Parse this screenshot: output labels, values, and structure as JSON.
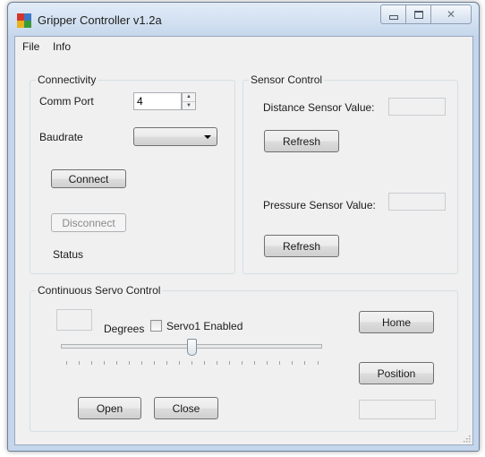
{
  "window": {
    "title": "Gripper Controller v1.2a",
    "controls": {
      "minimize": "minimize",
      "maximize": "maximize",
      "close": "✕"
    }
  },
  "menu": {
    "items": [
      "File",
      "Info"
    ]
  },
  "connectivity": {
    "title": "Connectivity",
    "comm_port_label": "Comm Port",
    "comm_port_value": "4",
    "baudrate_label": "Baudrate",
    "baudrate_value": "",
    "connect_label": "Connect",
    "disconnect_label": "Disconnect",
    "status_label": "Status"
  },
  "sensor_control": {
    "title": "Sensor Control",
    "distance_label": "Distance Sensor Value:",
    "distance_value": "",
    "refresh_distance_label": "Refresh",
    "pressure_label": "Pressure Sensor Value:",
    "pressure_value": "",
    "refresh_pressure_label": "Refresh"
  },
  "servo_control": {
    "title": "Continuous Servo Control",
    "degrees_value": "",
    "degrees_label": "Degrees",
    "servo1_label": "Servo1 Enabled",
    "servo1_checked": false,
    "slider_fraction": 0.5,
    "home_label": "Home",
    "position_label": "Position",
    "position_value": "",
    "open_label": "Open",
    "close_label": "Close"
  },
  "colors": {
    "window_frame": "#c4d6ec",
    "client_bg": "#f0f0f0",
    "group_border": "#d5dfe5"
  }
}
